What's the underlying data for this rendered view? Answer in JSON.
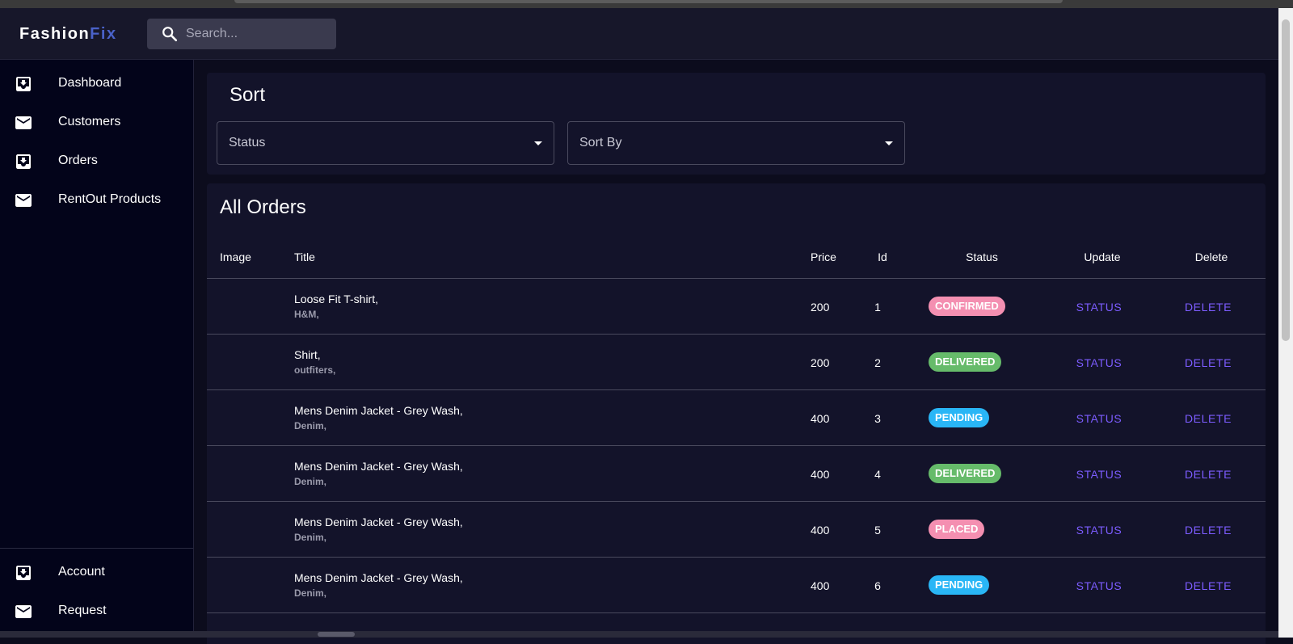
{
  "app": {
    "logo_main": "Fashion",
    "logo_accent": "Fix"
  },
  "search": {
    "placeholder": "Search..."
  },
  "sidebar": {
    "items": [
      {
        "label": "Dashboard",
        "icon": "inbox-download-icon"
      },
      {
        "label": "Customers",
        "icon": "mail-icon"
      },
      {
        "label": "Orders",
        "icon": "inbox-download-icon"
      },
      {
        "label": "RentOut Products",
        "icon": "mail-icon"
      }
    ],
    "bottom_items": [
      {
        "label": "Account",
        "icon": "inbox-download-icon"
      },
      {
        "label": "Request",
        "icon": "mail-icon"
      }
    ]
  },
  "sort": {
    "title": "Sort",
    "status_label": "Status",
    "sortby_label": "Sort By"
  },
  "orders": {
    "title": "All Orders",
    "columns": {
      "image": "Image",
      "title": "Title",
      "price": "Price",
      "id": "Id",
      "status": "Status",
      "update": "Update",
      "delete": "Delete"
    },
    "rows": [
      {
        "title": "Loose Fit T-shirt,",
        "brand": "H&M,",
        "price": "200",
        "id": "1",
        "status": "CONFIRMED",
        "update": "STATUS",
        "delete": "DELETE"
      },
      {
        "title": "Shirt,",
        "brand": "outfiters,",
        "price": "200",
        "id": "2",
        "status": "DELIVERED",
        "update": "STATUS",
        "delete": "DELETE"
      },
      {
        "title": "Mens Denim Jacket - Grey Wash,",
        "brand": "Denim,",
        "price": "400",
        "id": "3",
        "status": "PENDING",
        "update": "STATUS",
        "delete": "DELETE"
      },
      {
        "title": "Mens Denim Jacket - Grey Wash,",
        "brand": "Denim,",
        "price": "400",
        "id": "4",
        "status": "DELIVERED",
        "update": "STATUS",
        "delete": "DELETE"
      },
      {
        "title": "Mens Denim Jacket - Grey Wash,",
        "brand": "Denim,",
        "price": "400",
        "id": "5",
        "status": "PLACED",
        "update": "STATUS",
        "delete": "DELETE"
      },
      {
        "title": "Mens Denim Jacket - Grey Wash,",
        "brand": "Denim,",
        "price": "400",
        "id": "6",
        "status": "PENDING",
        "update": "STATUS",
        "delete": "DELETE"
      }
    ]
  },
  "status_colors": {
    "CONFIRMED": "#f48fb1",
    "DELIVERED": "#66bb6a",
    "PENDING": "#29b6f6",
    "PLACED": "#f48fb1"
  },
  "colors": {
    "accent": "#7c5cff",
    "logo_accent": "#4a62c9"
  }
}
